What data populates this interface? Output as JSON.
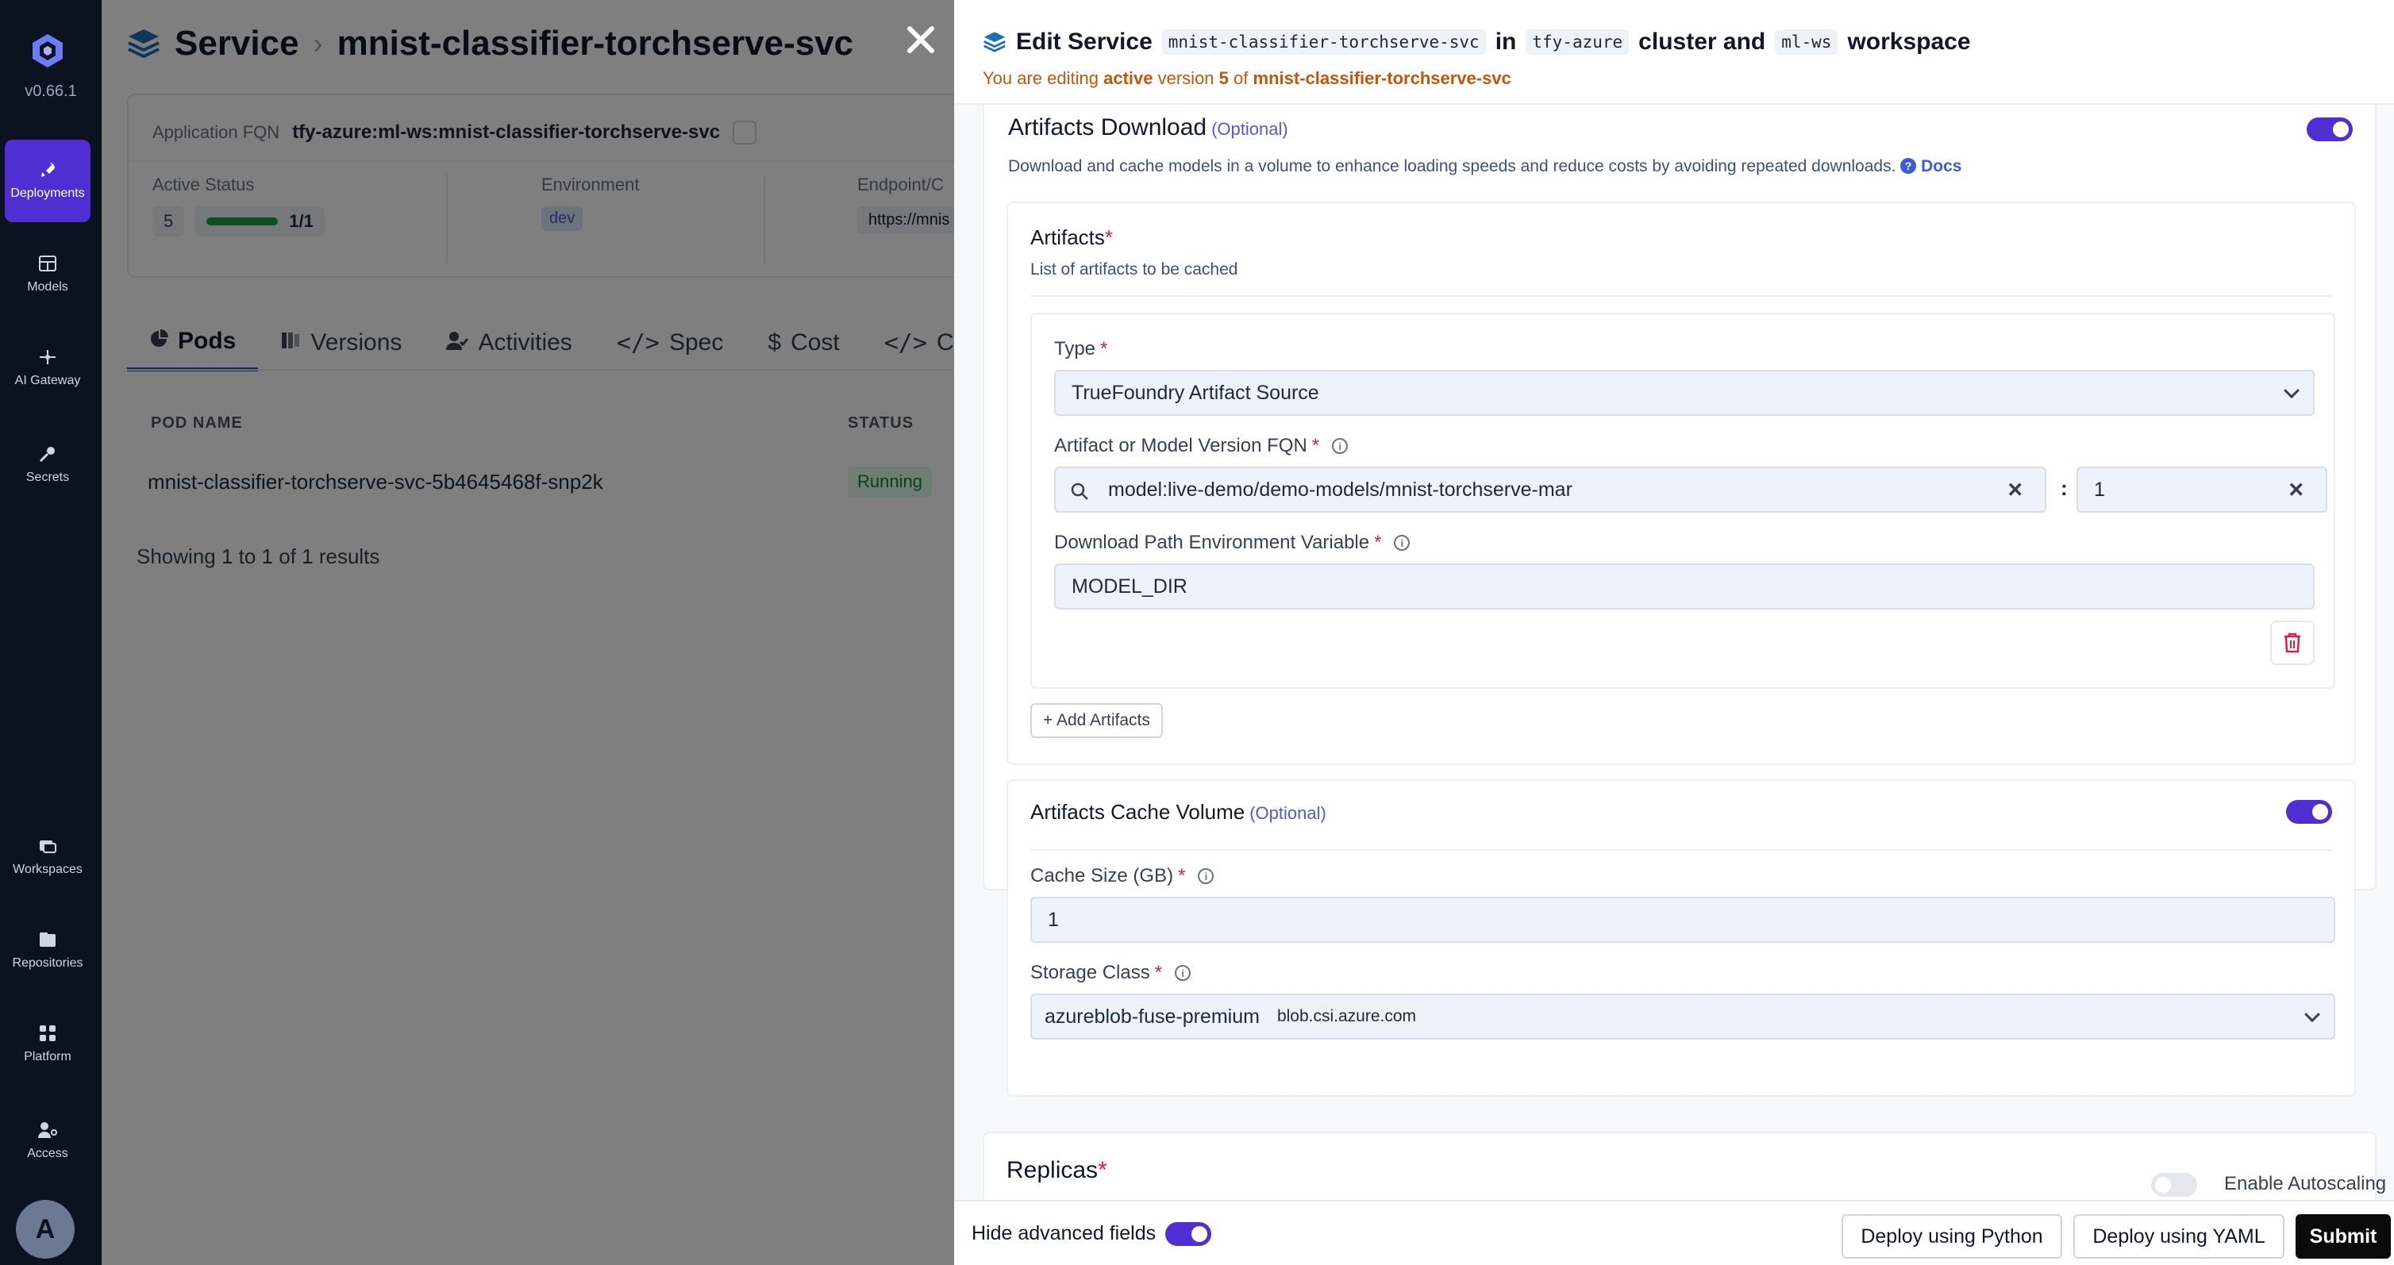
{
  "nav": {
    "version": "v0.66.1",
    "items": [
      {
        "label": "Deployments",
        "icon": "rocket-icon"
      },
      {
        "label": "Models",
        "icon": "grid-icon"
      },
      {
        "label": "AI Gateway",
        "icon": "gateway-icon"
      },
      {
        "label": "Secrets",
        "icon": "key-icon"
      },
      {
        "label": "Workspaces",
        "icon": "workspace-icon"
      },
      {
        "label": "Repositories",
        "icon": "repository-icon"
      },
      {
        "label": "Platform",
        "icon": "apps-icon"
      },
      {
        "label": "Access",
        "icon": "user-key-icon"
      }
    ],
    "avatar": "A"
  },
  "page": {
    "breadcrumb": {
      "type": "Service",
      "name": "mnist-classifier-torchserve-svc"
    },
    "fqn_label": "Application FQN",
    "fqn_value": "tfy-azure:ml-ws:mnist-classifier-torchserve-svc",
    "active_status_label": "Active Status",
    "active_version": "5",
    "replicas": "1/1",
    "environment_label": "Environment",
    "environment": "dev",
    "endpoint_label": "Endpoint/C",
    "endpoint": "https://mnis",
    "tabs": [
      "Pods",
      "Versions",
      "Activities",
      "Spec",
      "Cost",
      "C"
    ],
    "table": {
      "headers": [
        "POD NAME",
        "STATUS"
      ],
      "rows": [
        {
          "pod": "mnist-classifier-torchserve-svc-5b4645468f-snp2k",
          "status": "Running"
        }
      ]
    },
    "showing": "Showing 1 to 1 of 1 results"
  },
  "drawer": {
    "title_prefix": "Edit Service",
    "app_name": "mnist-classifier-torchserve-svc",
    "in": "in",
    "cluster": "tfy-azure",
    "cluster_and": "cluster and",
    "workspace": "ml-ws",
    "workspace_word": "workspace",
    "sub_prefix": "You are editing",
    "sub_active": "active",
    "sub_version": "version",
    "sub_version_num": "5",
    "sub_of": "of",
    "sub_app": "mnist-classifier-torchserve-svc",
    "artifacts_download": {
      "title": "Artifacts Download",
      "optional": "(Optional)",
      "description": "Download and cache models in a volume to enhance loading speeds and reduce costs by avoiding repeated downloads.",
      "docs": "Docs",
      "enabled": true
    },
    "artifacts": {
      "title": "Artifacts",
      "subtitle": "List of artifacts to be cached",
      "type_label": "Type",
      "type_value": "TrueFoundry Artifact Source",
      "fqn_label": "Artifact or Model Version FQN",
      "fqn_value": "model:live-demo/demo-models/mnist-torchserve-mar",
      "version_value": "1",
      "colon": ":",
      "env_label": "Download Path Environment Variable",
      "env_value": "MODEL_DIR",
      "add_button": "Add Artifacts"
    },
    "cache_volume": {
      "title": "Artifacts Cache Volume",
      "optional": "(Optional)",
      "enabled": true,
      "size_label": "Cache Size (GB)",
      "size_value": "1",
      "storage_label": "Storage Class",
      "storage_value": "azureblob-fuse-premium",
      "storage_provisioner": "blob.csi.azure.com"
    },
    "replicas": {
      "title": "Replicas",
      "autoscaling_label": "Enable Autoscaling",
      "autoscaling_enabled": false
    }
  },
  "footer": {
    "hide_advanced": "Hide advanced fields",
    "hide_advanced_enabled": true,
    "deploy_python": "Deploy using Python",
    "deploy_yaml": "Deploy using YAML",
    "submit": "Submit"
  },
  "colors": {
    "accent": "#4f2fd1",
    "nav_bg": "#0b1220",
    "warning_text": "#c2570b",
    "required": "#e11d48"
  }
}
